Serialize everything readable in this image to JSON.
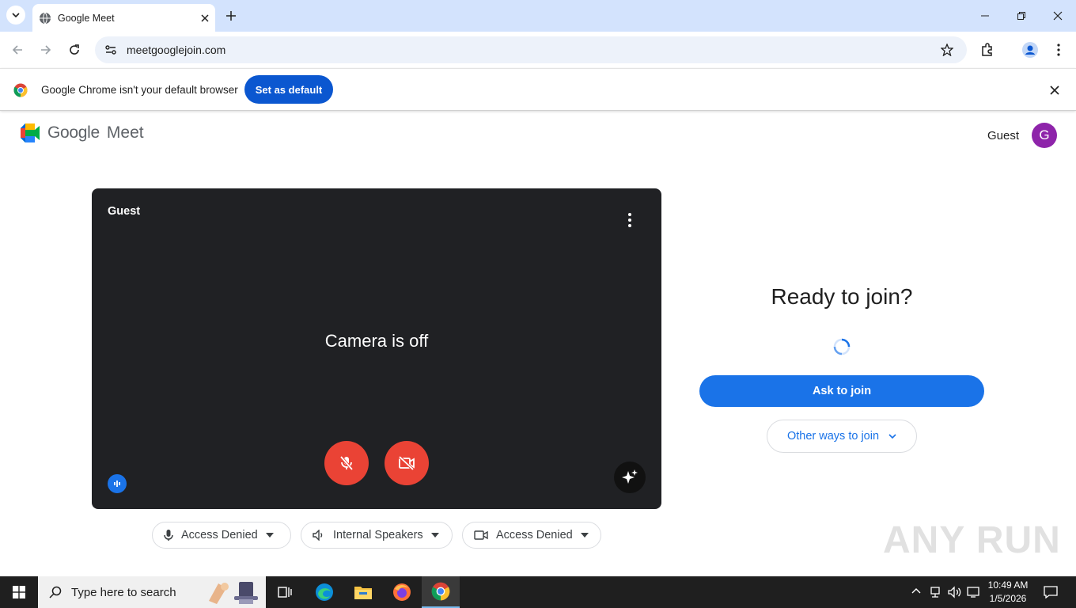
{
  "browser": {
    "tab_title": "Google Meet",
    "url": "meetgooglejoin.com"
  },
  "infobar": {
    "message": "Google Chrome isn't your default browser",
    "button_label": "Set as default"
  },
  "meet": {
    "logo_google": "Google",
    "logo_meet": "Meet",
    "account_name": "Guest",
    "avatar_letter": "G",
    "preview": {
      "name": "Guest",
      "status": "Camera is off"
    },
    "devices": [
      {
        "label": "Access Denied",
        "icon": "mic-icon"
      },
      {
        "label": "Internal Speakers",
        "icon": "speaker-icon"
      },
      {
        "label": "Access Denied",
        "icon": "camera-icon"
      }
    ],
    "ready_title": "Ready to join?",
    "ask_join_label": "Ask to join",
    "other_ways_label": "Other ways to join"
  },
  "watermark": "ANY RUN",
  "taskbar": {
    "search_placeholder": "Type here to search",
    "time": "10:49 AM",
    "date": "1/5/2026"
  },
  "colors": {
    "accent": "#1a73e8",
    "danger": "#ea4335",
    "avatar": "#8e24aa",
    "tabbar": "#d3e3fd"
  }
}
